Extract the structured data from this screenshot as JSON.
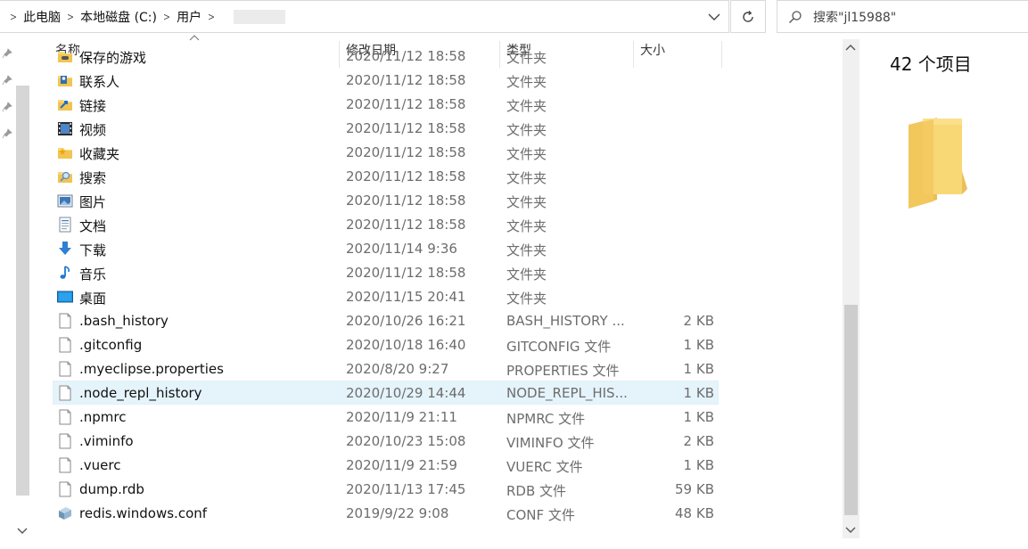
{
  "breadcrumb": {
    "items": [
      "此电脑",
      "本地磁盘 (C:)",
      "用户"
    ]
  },
  "search": {
    "placeholder": "搜索\"jl15988\""
  },
  "columns": {
    "name": "名称",
    "date": "修改日期",
    "type": "类型",
    "size": "大小"
  },
  "files": [
    {
      "name": "保存的游戏",
      "date": "2020/11/12 18:58",
      "type": "文件夹",
      "size": "",
      "icon": "saved-games-icon"
    },
    {
      "name": "联系人",
      "date": "2020/11/12 18:58",
      "type": "文件夹",
      "size": "",
      "icon": "contacts-folder-icon"
    },
    {
      "name": "链接",
      "date": "2020/11/12 18:58",
      "type": "文件夹",
      "size": "",
      "icon": "links-folder-icon"
    },
    {
      "name": "视频",
      "date": "2020/11/12 18:58",
      "type": "文件夹",
      "size": "",
      "icon": "videos-folder-icon"
    },
    {
      "name": "收藏夹",
      "date": "2020/11/12 18:58",
      "type": "文件夹",
      "size": "",
      "icon": "favorites-folder-icon"
    },
    {
      "name": "搜索",
      "date": "2020/11/12 18:58",
      "type": "文件夹",
      "size": "",
      "icon": "searches-folder-icon"
    },
    {
      "name": "图片",
      "date": "2020/11/12 18:58",
      "type": "文件夹",
      "size": "",
      "icon": "pictures-folder-icon"
    },
    {
      "name": "文档",
      "date": "2020/11/12 18:58",
      "type": "文件夹",
      "size": "",
      "icon": "documents-folder-icon"
    },
    {
      "name": "下载",
      "date": "2020/11/14 9:36",
      "type": "文件夹",
      "size": "",
      "icon": "downloads-folder-icon"
    },
    {
      "name": "音乐",
      "date": "2020/11/12 18:58",
      "type": "文件夹",
      "size": "",
      "icon": "music-folder-icon"
    },
    {
      "name": "桌面",
      "date": "2020/11/15 20:41",
      "type": "文件夹",
      "size": "",
      "icon": "desktop-folder-icon"
    },
    {
      "name": ".bash_history",
      "date": "2020/10/26 16:21",
      "type": "BASH_HISTORY ...",
      "size": "2 KB",
      "icon": "file-icon"
    },
    {
      "name": ".gitconfig",
      "date": "2020/10/18 16:40",
      "type": "GITCONFIG 文件",
      "size": "1 KB",
      "icon": "file-icon"
    },
    {
      "name": ".myeclipse.properties",
      "date": "2020/8/20 9:27",
      "type": "PROPERTIES 文件",
      "size": "1 KB",
      "icon": "file-icon"
    },
    {
      "name": ".node_repl_history",
      "date": "2020/10/29 14:44",
      "type": "NODE_REPL_HIS...",
      "size": "1 KB",
      "icon": "file-icon",
      "selected": true
    },
    {
      "name": ".npmrc",
      "date": "2020/11/9 21:11",
      "type": "NPMRC 文件",
      "size": "1 KB",
      "icon": "file-icon"
    },
    {
      "name": ".viminfo",
      "date": "2020/10/23 15:08",
      "type": "VIMINFO 文件",
      "size": "2 KB",
      "icon": "file-icon"
    },
    {
      "name": ".vuerc",
      "date": "2020/11/9 21:59",
      "type": "VUERC 文件",
      "size": "1 KB",
      "icon": "file-icon"
    },
    {
      "name": "dump.rdb",
      "date": "2020/11/13 17:45",
      "type": "RDB 文件",
      "size": "59 KB",
      "icon": "file-icon"
    },
    {
      "name": "redis.windows.conf",
      "date": "2019/9/22 9:08",
      "type": "CONF 文件",
      "size": "48 KB",
      "icon": "conf-file-icon"
    }
  ],
  "preview": {
    "item_count": "42 个项目"
  },
  "colors": {
    "selection": "#e5f3fb",
    "folder": "#f8d775",
    "accent": "#1979ca"
  }
}
